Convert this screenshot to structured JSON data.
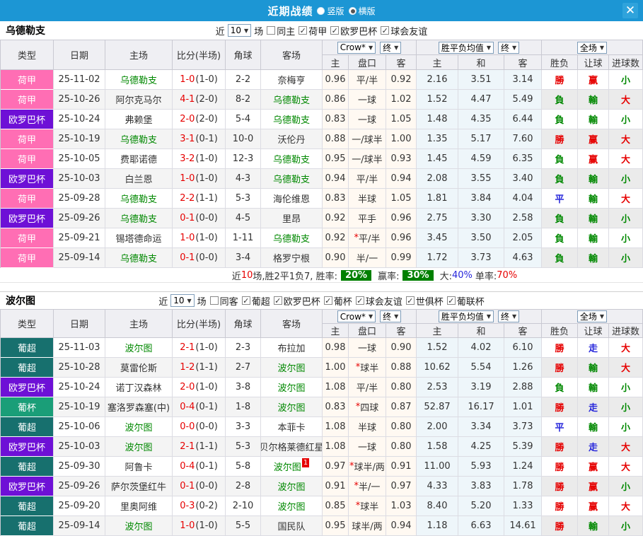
{
  "titlebar": {
    "title": "近期战绩",
    "radio_options": [
      {
        "label": "竖版",
        "selected": false
      },
      {
        "label": "横版",
        "selected": true
      }
    ],
    "close_icon": "✕"
  },
  "ui": {
    "arrow": "▼"
  },
  "selects": {
    "odds_source": "Crow*",
    "final_1": "终",
    "avg": "胜平负均值",
    "final_2": "终",
    "full_match": "全场"
  },
  "columns": {
    "type": "类型",
    "date": "日期",
    "home": "主场",
    "score": "比分(半场)",
    "corner": "角球",
    "away": "客场",
    "odds_home": "主",
    "odds_hc": "盘口",
    "odds_away": "客",
    "avg_home": "主",
    "avg_draw": "和",
    "avg_away": "客",
    "result_wdl": "胜负",
    "result_hc": "让球",
    "result_goals": "进球数"
  },
  "league_colors": {
    "荷甲": "#FF6EB4",
    "欧罗巴杯": "#6E10D6",
    "葡超": "#17706E",
    "葡杯": "#1A9E78"
  },
  "result_colors": {
    "red": "#E60000",
    "green": "#008800",
    "blue": "#2626DB"
  },
  "summary_badge_bg": "#008000",
  "topbar_color": "#1C96D4",
  "sections": [
    {
      "team": "乌德勒支",
      "filter": {
        "near": "近",
        "count": "10",
        "games": "场",
        "same": {
          "label": "同主",
          "checked": false
        },
        "leagues": [
          {
            "label": "荷甲",
            "checked": true
          },
          {
            "label": "欧罗巴杯",
            "checked": true
          },
          {
            "label": "球会友谊",
            "checked": true
          }
        ]
      },
      "rows": [
        {
          "league": "荷甲",
          "date": "25-11-02",
          "home": "乌德勒支",
          "home_focus": true,
          "score": "1-0",
          "half": "(1-0)",
          "corner": "2-2",
          "away": "奈梅亨",
          "away_focus": false,
          "away_sup": null,
          "o_home": "0.96",
          "handicap": "平/半",
          "o_away": "0.92",
          "avg_home": "2.16",
          "avg_draw": "3.51",
          "avg_away": "3.14",
          "res": [
            [
              "勝",
              "red"
            ],
            [
              "赢",
              "red"
            ],
            [
              "小",
              "green"
            ]
          ]
        },
        {
          "league": "荷甲",
          "date": "25-10-26",
          "home": "阿尔克马尔",
          "home_focus": false,
          "score": "4-1",
          "half": "(2-0)",
          "corner": "8-2",
          "away": "乌德勒支",
          "away_focus": true,
          "away_sup": null,
          "o_home": "0.86",
          "handicap": "一球",
          "o_away": "1.02",
          "avg_home": "1.52",
          "avg_draw": "4.47",
          "avg_away": "5.49",
          "res": [
            [
              "負",
              "green"
            ],
            [
              "輸",
              "green"
            ],
            [
              "大",
              "red"
            ]
          ]
        },
        {
          "league": "欧罗巴杯",
          "date": "25-10-24",
          "home": "弗赖堡",
          "home_focus": false,
          "score": "2-0",
          "half": "(2-0)",
          "corner": "5-4",
          "away": "乌德勒支",
          "away_focus": true,
          "away_sup": null,
          "o_home": "0.83",
          "handicap": "一球",
          "o_away": "1.05",
          "avg_home": "1.48",
          "avg_draw": "4.35",
          "avg_away": "6.44",
          "res": [
            [
              "負",
              "green"
            ],
            [
              "輸",
              "green"
            ],
            [
              "小",
              "green"
            ]
          ]
        },
        {
          "league": "荷甲",
          "date": "25-10-19",
          "home": "乌德勒支",
          "home_focus": true,
          "score": "3-1",
          "half": "(0-1)",
          "corner": "10-0",
          "away": "沃伦丹",
          "away_focus": false,
          "away_sup": null,
          "o_home": "0.88",
          "handicap": "一/球半",
          "o_away": "1.00",
          "avg_home": "1.35",
          "avg_draw": "5.17",
          "avg_away": "7.60",
          "res": [
            [
              "勝",
              "red"
            ],
            [
              "赢",
              "red"
            ],
            [
              "大",
              "red"
            ]
          ]
        },
        {
          "league": "荷甲",
          "date": "25-10-05",
          "home": "费耶诺德",
          "home_focus": false,
          "score": "3-2",
          "half": "(1-0)",
          "corner": "12-3",
          "away": "乌德勒支",
          "away_focus": true,
          "away_sup": null,
          "o_home": "0.95",
          "handicap": "一/球半",
          "o_away": "0.93",
          "avg_home": "1.45",
          "avg_draw": "4.59",
          "avg_away": "6.35",
          "res": [
            [
              "負",
              "green"
            ],
            [
              "赢",
              "red"
            ],
            [
              "大",
              "red"
            ]
          ]
        },
        {
          "league": "欧罗巴杯",
          "date": "25-10-03",
          "home": "白兰恩",
          "home_focus": false,
          "score": "1-0",
          "half": "(1-0)",
          "corner": "4-3",
          "away": "乌德勒支",
          "away_focus": true,
          "away_sup": null,
          "o_home": "0.94",
          "handicap": "平/半",
          "o_away": "0.94",
          "avg_home": "2.08",
          "avg_draw": "3.55",
          "avg_away": "3.40",
          "res": [
            [
              "負",
              "green"
            ],
            [
              "輸",
              "green"
            ],
            [
              "小",
              "green"
            ]
          ]
        },
        {
          "league": "荷甲",
          "date": "25-09-28",
          "home": "乌德勒支",
          "home_focus": true,
          "score": "2-2",
          "half": "(1-1)",
          "corner": "5-3",
          "away": "海伦维恩",
          "away_focus": false,
          "away_sup": null,
          "o_home": "0.83",
          "handicap": "半球",
          "o_away": "1.05",
          "avg_home": "1.81",
          "avg_draw": "3.84",
          "avg_away": "4.04",
          "res": [
            [
              "平",
              "blue"
            ],
            [
              "輸",
              "green"
            ],
            [
              "大",
              "red"
            ]
          ]
        },
        {
          "league": "欧罗巴杯",
          "date": "25-09-26",
          "home": "乌德勒支",
          "home_focus": true,
          "score": "0-1",
          "half": "(0-0)",
          "corner": "4-5",
          "away": "里昂",
          "away_focus": false,
          "away_sup": null,
          "o_home": "0.92",
          "handicap": "平手",
          "o_away": "0.96",
          "avg_home": "2.75",
          "avg_draw": "3.30",
          "avg_away": "2.58",
          "res": [
            [
              "負",
              "green"
            ],
            [
              "輸",
              "green"
            ],
            [
              "小",
              "green"
            ]
          ]
        },
        {
          "league": "荷甲",
          "date": "25-09-21",
          "home": "锡塔德命运",
          "home_focus": false,
          "score": "1-0",
          "half": "(1-0)",
          "corner": "1-11",
          "away": "乌德勒支",
          "away_focus": true,
          "away_sup": null,
          "o_home": "0.92",
          "handicap": "*平/半",
          "o_away": "0.96",
          "avg_home": "3.45",
          "avg_draw": "3.50",
          "avg_away": "2.05",
          "res": [
            [
              "負",
              "green"
            ],
            [
              "輸",
              "green"
            ],
            [
              "小",
              "green"
            ]
          ]
        },
        {
          "league": "荷甲",
          "date": "25-09-14",
          "home": "乌德勒支",
          "home_focus": true,
          "score": "0-1",
          "half": "(0-0)",
          "corner": "3-4",
          "away": "格罗宁根",
          "away_focus": false,
          "away_sup": null,
          "o_home": "0.90",
          "handicap": "半/一",
          "o_away": "0.99",
          "avg_home": "1.72",
          "avg_draw": "3.73",
          "avg_away": "4.63",
          "res": [
            [
              "負",
              "green"
            ],
            [
              "輸",
              "green"
            ],
            [
              "小",
              "green"
            ]
          ]
        }
      ],
      "summary": {
        "seg1": "近",
        "seg1_num": "10",
        "seg2": "场,胜2平1负7, 胜率:",
        "rate1": "20%",
        "seg3": "赢率:",
        "rate2": "30%",
        "seg4": "大:",
        "rate3": "40%",
        "seg5": "单率:",
        "rate4": "70%"
      }
    },
    {
      "team": "波尔图",
      "filter": {
        "near": "近",
        "count": "10",
        "games": "场",
        "same": {
          "label": "同客",
          "checked": false
        },
        "leagues": [
          {
            "label": "葡超",
            "checked": true
          },
          {
            "label": "欧罗巴杯",
            "checked": true
          },
          {
            "label": "葡杯",
            "checked": true
          },
          {
            "label": "球会友谊",
            "checked": true
          },
          {
            "label": "世俱杯",
            "checked": true
          },
          {
            "label": "葡联杯",
            "checked": true
          }
        ]
      },
      "rows": [
        {
          "league": "葡超",
          "date": "25-11-03",
          "home": "波尔图",
          "home_focus": true,
          "score": "2-1",
          "half": "(1-0)",
          "corner": "2-3",
          "away": "布拉加",
          "away_focus": false,
          "away_sup": null,
          "o_home": "0.98",
          "handicap": "一球",
          "o_away": "0.90",
          "avg_home": "1.52",
          "avg_draw": "4.02",
          "avg_away": "6.10",
          "res": [
            [
              "勝",
              "red"
            ],
            [
              "走",
              "blue"
            ],
            [
              "大",
              "red"
            ]
          ]
        },
        {
          "league": "葡超",
          "date": "25-10-28",
          "home": "莫雷伦斯",
          "home_focus": false,
          "score": "1-2",
          "half": "(1-1)",
          "corner": "2-7",
          "away": "波尔图",
          "away_focus": true,
          "away_sup": null,
          "o_home": "1.00",
          "handicap": "*球半",
          "o_away": "0.88",
          "avg_home": "10.62",
          "avg_draw": "5.54",
          "avg_away": "1.26",
          "res": [
            [
              "勝",
              "red"
            ],
            [
              "輸",
              "green"
            ],
            [
              "大",
              "red"
            ]
          ]
        },
        {
          "league": "欧罗巴杯",
          "date": "25-10-24",
          "home": "诺丁汉森林",
          "home_focus": false,
          "score": "2-0",
          "half": "(1-0)",
          "corner": "3-8",
          "away": "波尔图",
          "away_focus": true,
          "away_sup": null,
          "o_home": "1.08",
          "handicap": "平/半",
          "o_away": "0.80",
          "avg_home": "2.53",
          "avg_draw": "3.19",
          "avg_away": "2.88",
          "res": [
            [
              "負",
              "green"
            ],
            [
              "輸",
              "green"
            ],
            [
              "小",
              "green"
            ]
          ]
        },
        {
          "league": "葡杯",
          "date": "25-10-19",
          "home": "塞洛罗森塞(中)",
          "home_focus": false,
          "score": "0-4",
          "half": "(0-1)",
          "corner": "1-8",
          "away": "波尔图",
          "away_focus": true,
          "away_sup": null,
          "o_home": "0.83",
          "handicap": "*四球",
          "o_away": "0.87",
          "avg_home": "52.87",
          "avg_draw": "16.17",
          "avg_away": "1.01",
          "res": [
            [
              "勝",
              "red"
            ],
            [
              "走",
              "blue"
            ],
            [
              "小",
              "green"
            ]
          ]
        },
        {
          "league": "葡超",
          "date": "25-10-06",
          "home": "波尔图",
          "home_focus": true,
          "score": "0-0",
          "half": "(0-0)",
          "corner": "3-3",
          "away": "本菲卡",
          "away_focus": false,
          "away_sup": null,
          "o_home": "1.08",
          "handicap": "半球",
          "o_away": "0.80",
          "avg_home": "2.00",
          "avg_draw": "3.34",
          "avg_away": "3.73",
          "res": [
            [
              "平",
              "blue"
            ],
            [
              "輸",
              "green"
            ],
            [
              "小",
              "green"
            ]
          ]
        },
        {
          "league": "欧罗巴杯",
          "date": "25-10-03",
          "home": "波尔图",
          "home_focus": true,
          "score": "2-1",
          "half": "(1-1)",
          "corner": "5-3",
          "away": "贝尔格莱德红星",
          "away_focus": false,
          "away_sup": null,
          "o_home": "1.08",
          "handicap": "一球",
          "o_away": "0.80",
          "avg_home": "1.58",
          "avg_draw": "4.25",
          "avg_away": "5.39",
          "res": [
            [
              "勝",
              "red"
            ],
            [
              "走",
              "blue"
            ],
            [
              "大",
              "red"
            ]
          ]
        },
        {
          "league": "葡超",
          "date": "25-09-30",
          "home": "阿鲁卡",
          "home_focus": false,
          "score": "0-4",
          "half": "(0-1)",
          "corner": "5-8",
          "away": "波尔图",
          "away_focus": true,
          "away_sup": "1",
          "o_home": "0.97",
          "handicap": "*球半/两",
          "o_away": "0.91",
          "avg_home": "11.00",
          "avg_draw": "5.93",
          "avg_away": "1.24",
          "res": [
            [
              "勝",
              "red"
            ],
            [
              "赢",
              "red"
            ],
            [
              "大",
              "red"
            ]
          ]
        },
        {
          "league": "欧罗巴杯",
          "date": "25-09-26",
          "home": "萨尔茨堡红牛",
          "home_focus": false,
          "score": "0-1",
          "half": "(0-0)",
          "corner": "2-8",
          "away": "波尔图",
          "away_focus": true,
          "away_sup": null,
          "o_home": "0.91",
          "handicap": "*半/一",
          "o_away": "0.97",
          "avg_home": "4.33",
          "avg_draw": "3.83",
          "avg_away": "1.78",
          "res": [
            [
              "勝",
              "red"
            ],
            [
              "赢",
              "red"
            ],
            [
              "小",
              "green"
            ]
          ]
        },
        {
          "league": "葡超",
          "date": "25-09-20",
          "home": "里奥阿维",
          "home_focus": false,
          "score": "0-3",
          "half": "(0-2)",
          "corner": "2-10",
          "away": "波尔图",
          "away_focus": true,
          "away_sup": null,
          "o_home": "0.85",
          "handicap": "*球半",
          "o_away": "1.03",
          "avg_home": "8.40",
          "avg_draw": "5.20",
          "avg_away": "1.33",
          "res": [
            [
              "勝",
              "red"
            ],
            [
              "赢",
              "red"
            ],
            [
              "大",
              "red"
            ]
          ]
        },
        {
          "league": "葡超",
          "date": "25-09-14",
          "home": "波尔图",
          "home_focus": true,
          "score": "1-0",
          "half": "(1-0)",
          "corner": "5-5",
          "away": "国民队",
          "away_focus": false,
          "away_sup": null,
          "o_home": "0.95",
          "handicap": "球半/两",
          "o_away": "0.94",
          "avg_home": "1.18",
          "avg_draw": "6.63",
          "avg_away": "14.61",
          "res": [
            [
              "勝",
              "red"
            ],
            [
              "輸",
              "green"
            ],
            [
              "小",
              "green"
            ]
          ]
        }
      ],
      "summary": null
    }
  ]
}
